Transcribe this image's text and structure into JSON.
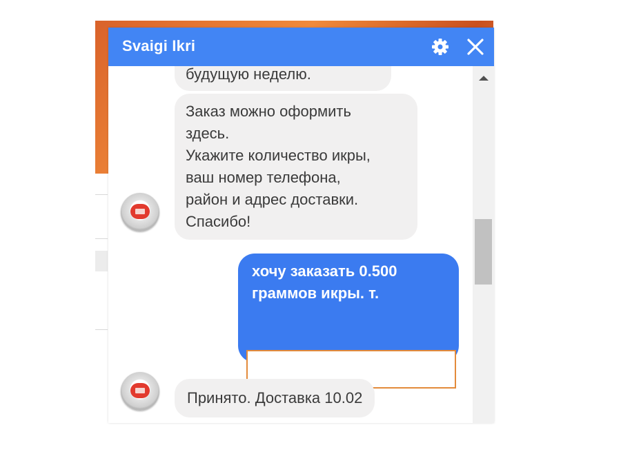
{
  "chat": {
    "title": "Svaigi Ikri",
    "header_icons": [
      "gear-icon",
      "close-icon"
    ],
    "messages": [
      {
        "from": "page",
        "lines": [
          "будущую неделю."
        ]
      },
      {
        "from": "page",
        "lines": [
          "Заказ можно оформить",
          "здесь.",
          "Укажите количество икры,",
          "ваш номер телефона,",
          "район и адрес доставки.",
          "Спасибо!"
        ]
      },
      {
        "from": "user",
        "lines": [
          "хочу заказать 0.500",
          "граммов икры. т."
        ]
      },
      {
        "from": "page",
        "lines": [
          "Принято. Доставка 10.02"
        ]
      }
    ]
  },
  "colors": {
    "header": "#4285f4",
    "outgoing_bubble": "#3b7bf0",
    "incoming_bubble": "#f1f0f0",
    "redaction_border": "#e38a3a"
  }
}
